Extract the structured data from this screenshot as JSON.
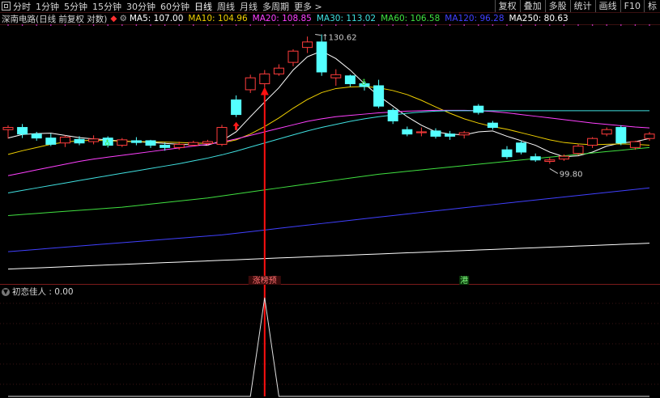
{
  "toolbar": {
    "periods": [
      "分时",
      "1分钟",
      "5分钟",
      "15分钟",
      "30分钟",
      "60分钟",
      "日线",
      "周线",
      "月线",
      "多周期",
      "更多 >"
    ],
    "active": "日线",
    "right_buttons": [
      "复权",
      "叠加",
      "多股",
      "统计",
      "画线",
      "F10",
      "标"
    ]
  },
  "info": {
    "stock": "深南电路(日线 前复权 对数)",
    "mas": [
      {
        "label": "MA5: 107.00",
        "color": "#ffffff"
      },
      {
        "label": "MA10: 104.96",
        "color": "#f0d000"
      },
      {
        "label": "MA20: 108.85",
        "color": "#ff40ff"
      },
      {
        "label": "MA30: 113.02",
        "color": "#40e0e0"
      },
      {
        "label": "MA60: 106.58",
        "color": "#40e040"
      },
      {
        "label": "MA120: 96.28",
        "color": "#4040ff"
      },
      {
        "label": "MA250: 80.63",
        "color": "#ffffff"
      }
    ]
  },
  "indicator": {
    "title": "初恋佳人 : 0.00"
  },
  "chart_data": {
    "type": "candlestick",
    "price_axis": "log",
    "ylim": [
      78,
      133
    ],
    "annotations": {
      "high_label": "130.62",
      "low_label": "99.80",
      "signal_label": "涨榜预",
      "marker_label": "港"
    },
    "candles": [
      [
        106.5,
        107.0,
        104.5,
        107.5
      ],
      [
        107.0,
        105.5,
        104.6,
        107.8
      ],
      [
        105.5,
        104.6,
        104.0,
        106.0
      ],
      [
        104.6,
        103.2,
        102.8,
        105.6
      ],
      [
        103.5,
        104.8,
        102.6,
        105.2
      ],
      [
        104.3,
        103.5,
        103.0,
        105.0
      ],
      [
        103.8,
        104.4,
        103.2,
        105.2
      ],
      [
        104.6,
        103.0,
        102.5,
        105.0
      ],
      [
        103.0,
        104.2,
        102.6,
        104.6
      ],
      [
        104.0,
        103.6,
        103.0,
        104.8
      ],
      [
        104.0,
        103.0,
        102.4,
        104.2
      ],
      [
        103.0,
        102.5,
        101.8,
        103.6
      ],
      [
        102.5,
        103.2,
        102.0,
        103.8
      ],
      [
        103.0,
        103.6,
        102.8,
        104.0
      ],
      [
        103.4,
        103.8,
        103.0,
        104.2
      ],
      [
        103.2,
        107.0,
        102.8,
        107.6
      ],
      [
        113.5,
        110.0,
        109.4,
        114.6
      ],
      [
        116.0,
        119.0,
        115.2,
        119.8
      ],
      [
        117.5,
        120.0,
        116.5,
        121.0
      ],
      [
        120.0,
        121.5,
        119.5,
        122.5
      ],
      [
        123.0,
        126.0,
        122.0,
        126.5
      ],
      [
        127.0,
        128.5,
        125.5,
        130.0
      ],
      [
        128.5,
        120.5,
        119.5,
        130.6
      ],
      [
        119.0,
        119.8,
        117.0,
        121.2
      ],
      [
        119.5,
        117.5,
        116.8,
        119.8
      ],
      [
        117.5,
        116.8,
        115.8,
        118.2
      ],
      [
        117.0,
        112.0,
        111.5,
        118.5
      ],
      [
        111.0,
        108.5,
        107.8,
        111.5
      ],
      [
        106.5,
        105.5,
        105.0,
        107.2
      ],
      [
        105.8,
        106.0,
        105.0,
        107.0
      ],
      [
        106.2,
        105.0,
        104.5,
        106.8
      ],
      [
        105.5,
        105.0,
        104.2,
        106.2
      ],
      [
        105.3,
        105.8,
        104.5,
        106.2
      ],
      [
        112.0,
        110.5,
        110.0,
        112.5
      ],
      [
        108.0,
        107.0,
        106.5,
        108.5
      ],
      [
        102.0,
        100.5,
        100.0,
        102.8
      ],
      [
        103.5,
        101.5,
        101.0,
        104.0
      ],
      [
        100.5,
        99.8,
        99.4,
        101.2
      ],
      [
        99.5,
        99.8,
        99.0,
        100.3
      ],
      [
        100.0,
        100.6,
        99.6,
        101.0
      ],
      [
        101.2,
        102.8,
        100.8,
        103.2
      ],
      [
        103.0,
        104.5,
        102.4,
        104.8
      ],
      [
        105.5,
        106.5,
        105.0,
        107.0
      ],
      [
        107.0,
        103.5,
        103.0,
        107.5
      ],
      [
        102.5,
        103.8,
        102.0,
        104.0
      ],
      [
        104.5,
        105.5,
        104.0,
        106.0
      ]
    ],
    "ma_series": [
      {
        "name": "MA5",
        "color": "#ffffff",
        "values": [
          104.6,
          105.4,
          105.6,
          105.7,
          105.2,
          104.7,
          104.4,
          104.2,
          103.9,
          103.8,
          103.6,
          103.4,
          103.2,
          103.1,
          103.0,
          104.0,
          106.0,
          109.5,
          113.0,
          116.5,
          121.0,
          124.5,
          126.0,
          124.0,
          121.0,
          117.5,
          114.5,
          112.0,
          109.5,
          107.5,
          106.0,
          105.5,
          105.3,
          106.0,
          106.2,
          105.0,
          104.0,
          103.0,
          101.5,
          100.5,
          100.7,
          101.5,
          102.8,
          103.5,
          103.8,
          104.5
        ]
      },
      {
        "name": "MA10",
        "color": "#f0d000",
        "values": [
          101.0,
          101.8,
          102.5,
          103.2,
          103.7,
          104.0,
          104.1,
          104.0,
          103.9,
          103.8,
          103.8,
          103.7,
          103.6,
          103.5,
          103.4,
          103.5,
          104.2,
          105.5,
          107.2,
          109.2,
          111.5,
          113.6,
          115.3,
          116.3,
          116.7,
          116.8,
          116.5,
          115.8,
          114.8,
          113.4,
          111.8,
          110.3,
          109.0,
          108.0,
          107.2,
          106.6,
          105.8,
          105.0,
          104.2,
          103.6,
          103.3,
          103.1,
          103.2,
          103.3,
          103.2,
          103.0
        ]
      },
      {
        "name": "MA20",
        "color": "#ff40ff",
        "values": [
          96.5,
          97.1,
          97.7,
          98.3,
          98.9,
          99.5,
          100.0,
          100.4,
          100.8,
          101.2,
          101.6,
          102.0,
          102.4,
          102.8,
          103.2,
          103.7,
          104.4,
          105.2,
          106.0,
          106.8,
          107.6,
          108.4,
          109.0,
          109.5,
          109.8,
          110.1,
          110.4,
          110.6,
          110.8,
          110.9,
          111.0,
          111.0,
          111.0,
          110.9,
          110.7,
          110.4,
          110.0,
          109.6,
          109.2,
          108.8,
          108.4,
          108.0,
          107.7,
          107.4,
          107.1,
          106.9
        ]
      },
      {
        "name": "MA30",
        "color": "#40e0e0",
        "values": [
          93.0,
          93.5,
          94.0,
          94.5,
          95.0,
          95.5,
          96.0,
          96.5,
          97.0,
          97.5,
          98.0,
          98.5,
          99.0,
          99.6,
          100.2,
          100.9,
          101.7,
          102.6,
          103.5,
          104.4,
          105.3,
          106.2,
          107.0,
          107.7,
          108.4,
          109.0,
          109.5,
          109.9,
          110.3,
          110.6,
          110.8,
          110.9,
          110.9,
          110.9,
          110.9,
          110.9,
          110.9,
          110.9,
          110.9,
          110.9,
          110.9,
          110.9,
          110.9,
          110.9,
          110.9,
          110.9
        ]
      },
      {
        "name": "MA60",
        "color": "#40e040",
        "values": [
          88.6,
          88.8,
          89.0,
          89.2,
          89.4,
          89.6,
          89.8,
          90.0,
          90.2,
          90.5,
          90.8,
          91.1,
          91.4,
          91.7,
          92.0,
          92.4,
          92.8,
          93.2,
          93.6,
          94.0,
          94.4,
          94.8,
          95.2,
          95.6,
          96.0,
          96.4,
          96.8,
          97.1,
          97.4,
          97.7,
          98.0,
          98.3,
          98.6,
          98.9,
          99.2,
          99.5,
          99.8,
          100.1,
          100.4,
          100.7,
          101.0,
          101.3,
          101.6,
          101.9,
          102.2,
          102.5
        ]
      },
      {
        "name": "MA120",
        "color": "#4040ff",
        "values": [
          82.0,
          82.2,
          82.4,
          82.6,
          82.8,
          83.0,
          83.2,
          83.4,
          83.6,
          83.8,
          84.0,
          84.2,
          84.4,
          84.6,
          84.8,
          85.0,
          85.3,
          85.6,
          85.9,
          86.2,
          86.5,
          86.8,
          87.1,
          87.4,
          87.7,
          88.0,
          88.3,
          88.6,
          88.9,
          89.2,
          89.5,
          89.8,
          90.1,
          90.4,
          90.7,
          91.0,
          91.3,
          91.6,
          91.9,
          92.2,
          92.5,
          92.8,
          93.1,
          93.4,
          93.7,
          94.0
        ]
      },
      {
        "name": "MA250",
        "color": "#ffffff",
        "values": [
          79.0,
          79.1,
          79.2,
          79.3,
          79.4,
          79.5,
          79.6,
          79.7,
          79.8,
          79.9,
          80.0,
          80.1,
          80.2,
          80.3,
          80.4,
          80.5,
          80.6,
          80.7,
          80.8,
          80.9,
          81.0,
          81.1,
          81.2,
          81.3,
          81.4,
          81.5,
          81.6,
          81.7,
          81.8,
          81.9,
          82.0,
          82.1,
          82.2,
          82.3,
          82.4,
          82.5,
          82.6,
          82.7,
          82.8,
          82.9,
          83.0,
          83.1,
          83.2,
          83.3,
          83.4,
          83.5
        ]
      }
    ],
    "signal_index": 18,
    "marker_index": 32,
    "indicator_values": [
      0,
      0,
      0,
      0,
      0,
      0,
      0,
      0,
      0,
      0,
      0,
      0,
      0,
      0,
      0,
      0,
      0,
      0,
      1,
      0,
      0,
      0,
      0,
      0,
      0,
      0,
      0,
      0,
      0,
      0,
      0,
      0,
      0,
      0,
      0,
      0,
      0,
      0,
      0,
      0,
      0,
      0,
      0,
      0,
      0,
      0
    ]
  }
}
